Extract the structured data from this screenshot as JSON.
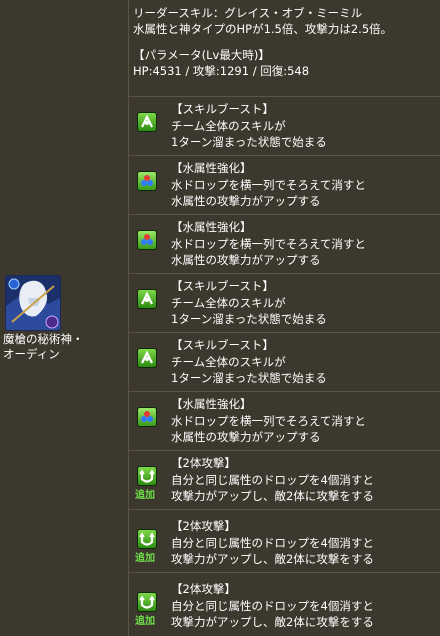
{
  "leader": {
    "line1": "リーダースキル：グレイス・オブ・ミーミル",
    "line2": "水属性と神タイプのHPが1.5倍、攻撃力は2.5倍。",
    "params_title": "【パラメータ(Lv最大時)】",
    "params": "HP:4531 / 攻撃:1291 / 回復:548"
  },
  "character": {
    "name_line1": "魔槍の秘術神・",
    "name_line2": "オーディン"
  },
  "awakenings": [
    {
      "icon": "skill-boost-icon",
      "title": "【スキルブースト】",
      "line1": "チーム全体のスキルが",
      "line2": "1ターン溜まった状態で始まる",
      "tag": ""
    },
    {
      "icon": "water-enhance-icon",
      "title": "【水属性強化】",
      "line1": "水ドロップを横一列でそろえて消すと",
      "line2": "水属性の攻撃力がアップする",
      "tag": ""
    },
    {
      "icon": "water-enhance-icon",
      "title": "【水属性強化】",
      "line1": "水ドロップを横一列でそろえて消すと",
      "line2": "水属性の攻撃力がアップする",
      "tag": ""
    },
    {
      "icon": "skill-boost-icon",
      "title": "【スキルブースト】",
      "line1": "チーム全体のスキルが",
      "line2": "1ターン溜まった状態で始まる",
      "tag": ""
    },
    {
      "icon": "skill-boost-icon",
      "title": "【スキルブースト】",
      "line1": "チーム全体のスキルが",
      "line2": "1ターン溜まった状態で始まる",
      "tag": ""
    },
    {
      "icon": "water-enhance-icon",
      "title": "【水属性強化】",
      "line1": "水ドロップを横一列でそろえて消すと",
      "line2": "水属性の攻撃力がアップする",
      "tag": ""
    },
    {
      "icon": "two-target-attack-icon",
      "title": "【2体攻撃】",
      "line1": "自分と同じ属性のドロップを4個消すと",
      "line2": "攻撃力がアップし、敵2体に攻撃をする",
      "tag": "追加"
    },
    {
      "icon": "two-target-attack-icon",
      "title": "【2体攻撃】",
      "line1": "自分と同じ属性のドロップを4個消すと",
      "line2": "攻撃力がアップし、敵2体に攻撃をする",
      "tag": "追加"
    },
    {
      "icon": "two-target-attack-icon",
      "title": "【2体攻撃】",
      "line1": "自分と同じ属性のドロップを4個消すと",
      "line2": "攻撃力がアップし、敵2体に攻撃をする",
      "tag": "追加"
    }
  ]
}
